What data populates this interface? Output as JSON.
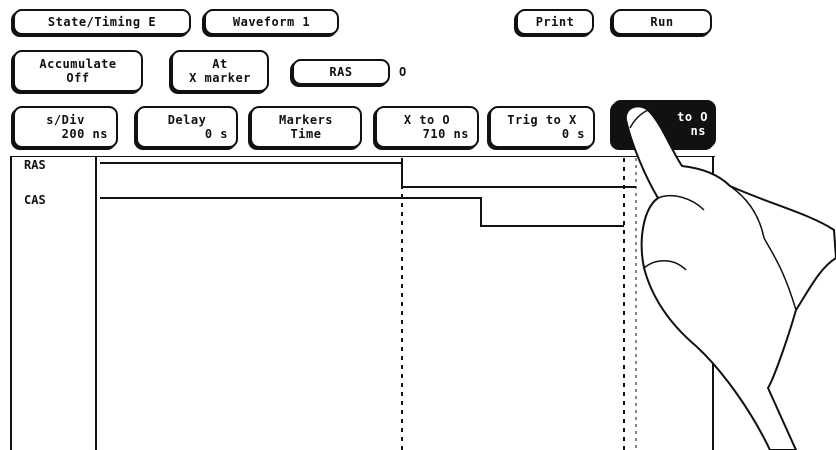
{
  "toolbar": {
    "menu1": "State/Timing E",
    "menu2": "Waveform 1",
    "print": "Print",
    "run": "Run"
  },
  "row2": {
    "accumulate_title": "Accumulate",
    "accumulate_value": "Off",
    "at_title": "At",
    "at_value": "X marker",
    "label_field": "RAS",
    "o_indicator": "O"
  },
  "row3": {
    "sdiv_title": "s/Div",
    "sdiv_value": "200 ns",
    "delay_title": "Delay",
    "delay_value": "0  s",
    "markers_title": "Markers",
    "markers_value": "Time",
    "xto_title": "X to O",
    "xto_value": "710 ns",
    "trig_title": "Trig to X",
    "trig_value": "0  s",
    "partial_title": "to O",
    "partial_value": "ns"
  },
  "waveforms": {
    "labels": [
      "RAS",
      "CAS"
    ]
  }
}
